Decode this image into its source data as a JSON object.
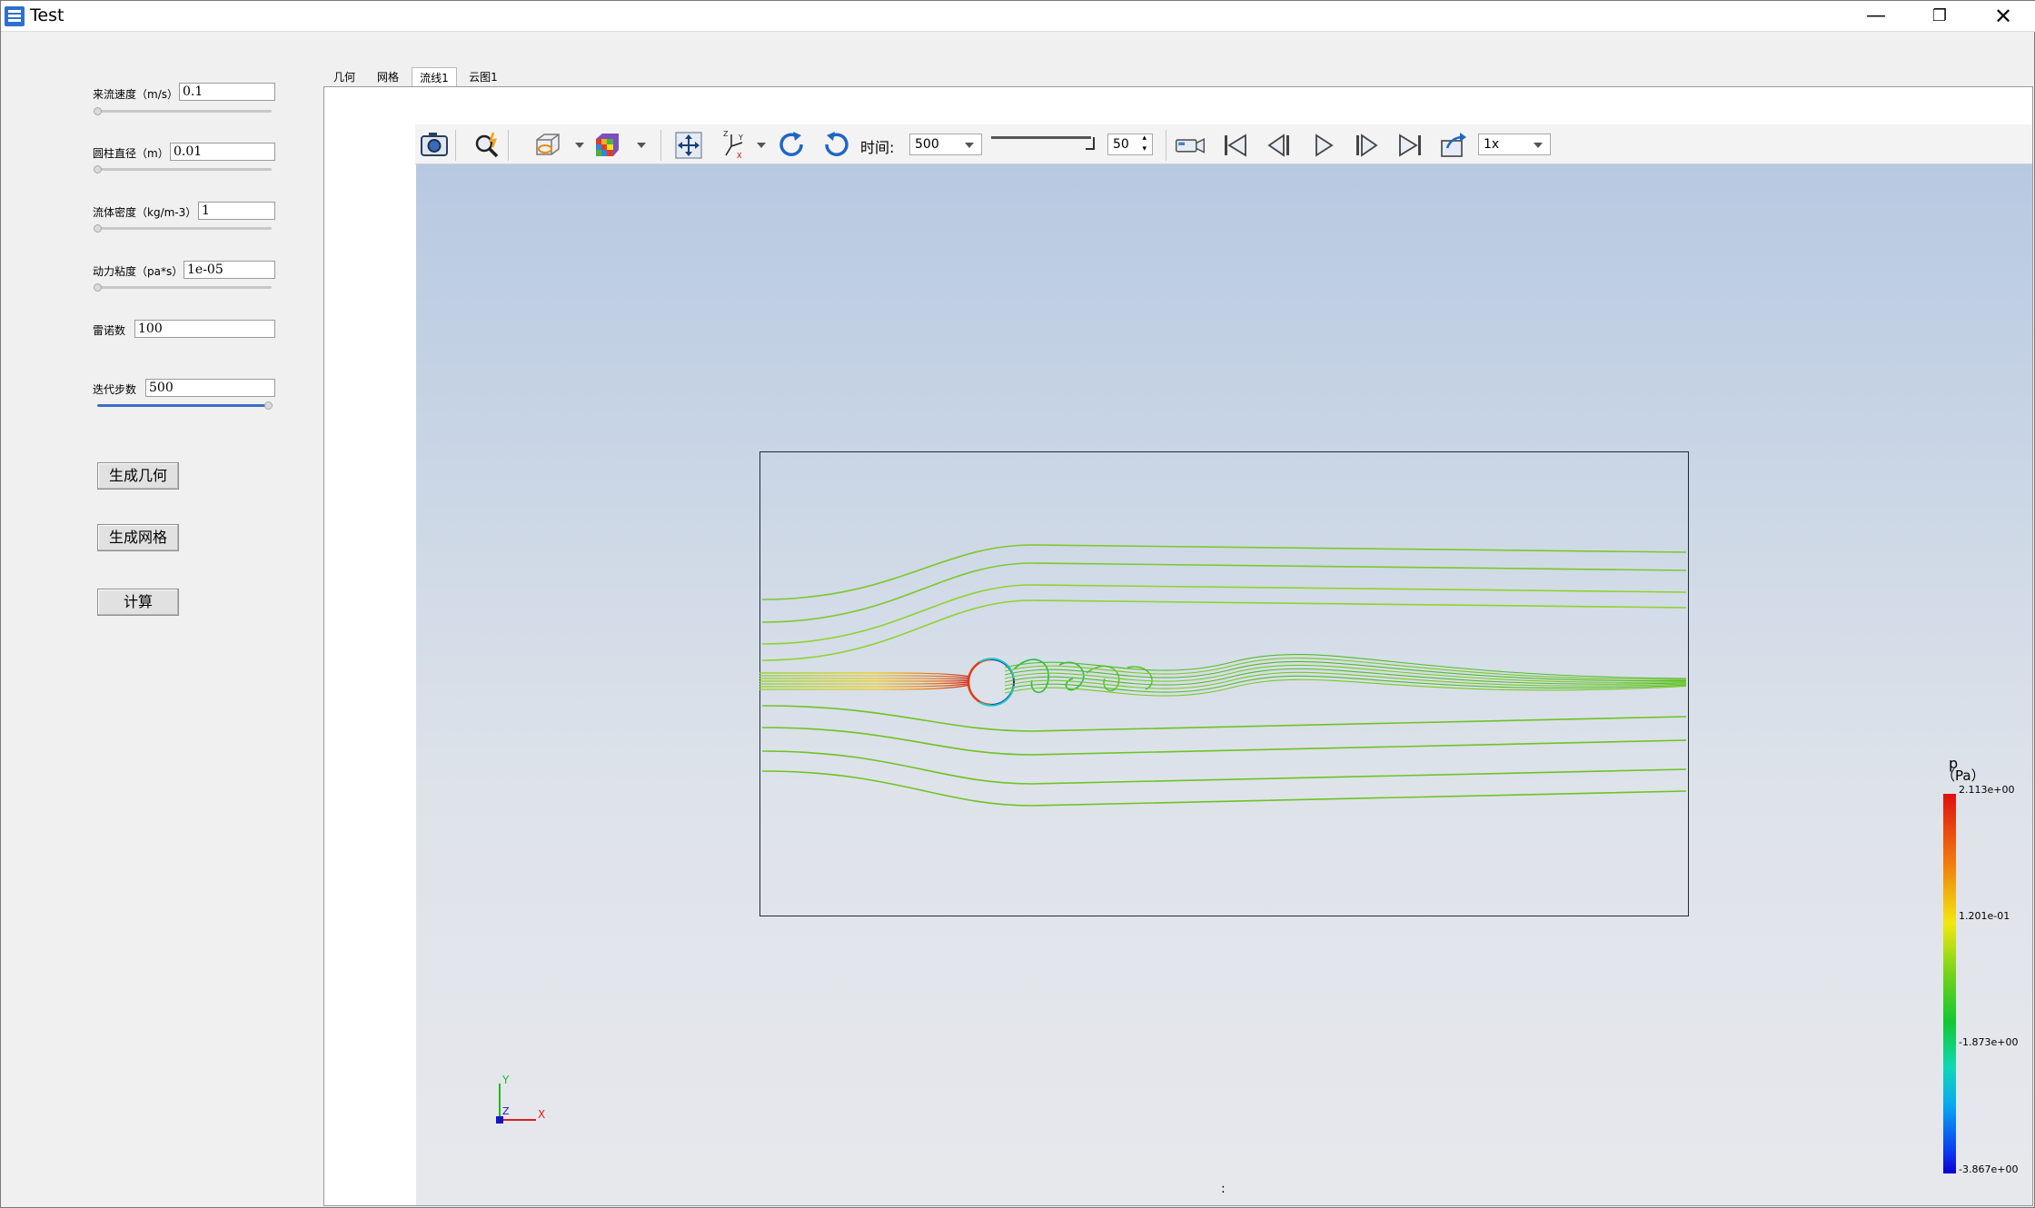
{
  "window": {
    "title": "Test"
  },
  "params": [
    {
      "label": "来流速度（m/s）",
      "value": "0.1"
    },
    {
      "label": "圆柱直径（m）",
      "value": "0.01"
    },
    {
      "label": "流体密度（kg/m-3）",
      "value": "1"
    },
    {
      "label": "动力粘度（pa*s）",
      "value": "1e-05"
    },
    {
      "label": "雷诺数",
      "value": "100"
    },
    {
      "label": "迭代步数",
      "value": "500"
    }
  ],
  "buttons": {
    "geometry": "生成几何",
    "mesh": "生成网格",
    "compute": "计算"
  },
  "tabs": [
    "几何",
    "网格",
    "流线1",
    "云图1"
  ],
  "active_tab": "流线1",
  "toolbar": {
    "time_label": "时间:",
    "time_value": "500",
    "frame_value": "50",
    "speed_value": "1x"
  },
  "icons": [
    "camera-icon",
    "zoom-icon",
    "display-mode-icon",
    "color-cube-icon",
    "reset-view-icon",
    "axes-icon",
    "rotate-cw-icon",
    "rotate-ccw-icon",
    "record-icon",
    "first-frame-icon",
    "prev-frame-icon",
    "play-icon",
    "next-frame-icon",
    "last-frame-icon",
    "export-icon"
  ],
  "colorbar": {
    "title": "p",
    "unit": "（Pa）",
    "labels": [
      "2.113e+00",
      "1.201e-01",
      "-1.873e+00",
      "-3.867e+00"
    ],
    "colors": [
      "#e01010",
      "#f2e80f",
      "#13c733",
      "#10d8b4",
      "#0a00d2"
    ]
  },
  "axes_triad": {
    "y": "Y",
    "z": "Z",
    "x": "X"
  },
  "status": ":"
}
